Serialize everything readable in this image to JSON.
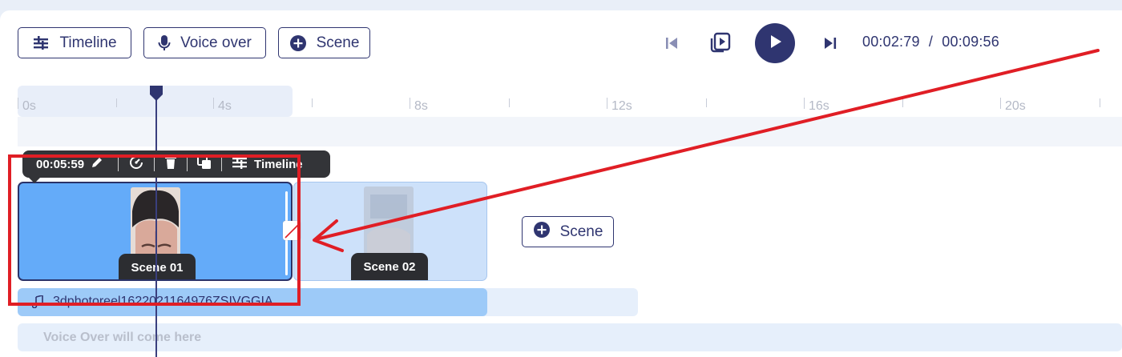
{
  "toolbar_top": {
    "timeline_label": "Timeline",
    "voiceover_label": "Voice over",
    "scene_label": "Scene"
  },
  "player": {
    "current_time": "00:02:79",
    "separator": "/",
    "total_time": "00:09:56"
  },
  "ruler": {
    "labels": [
      "0s",
      "4s",
      "8s",
      "12s",
      "16s",
      "20s"
    ]
  },
  "scene_toolbar": {
    "duration": "00:05:59",
    "timeline_label": "Timeline"
  },
  "scenes": [
    {
      "label": "Scene 01",
      "selected": true
    },
    {
      "label": "Scene 02",
      "selected": false
    }
  ],
  "add_scene_label": "Scene",
  "audio_track": {
    "filename": "3dphotoreel1622021164976ZSIVGGIA"
  },
  "voice_over": {
    "placeholder": "Voice Over will come here"
  },
  "colors": {
    "brand": "#2f3570",
    "scene_selected": "#64abf9",
    "scene_unselected": "#cde1fa",
    "annotation_red": "#e01e25"
  }
}
